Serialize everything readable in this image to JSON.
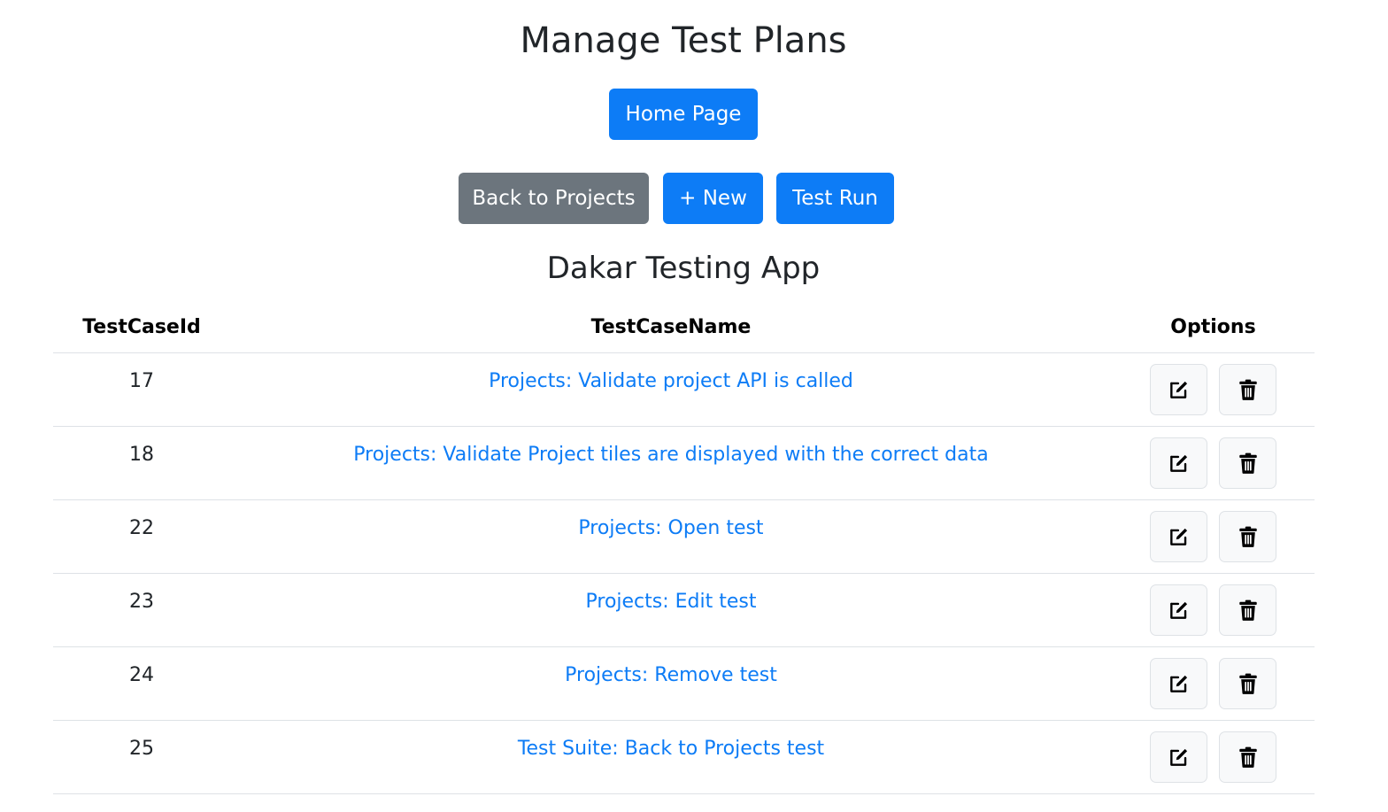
{
  "page": {
    "title": "Manage Test Plans"
  },
  "nav": {
    "home_label": "Home Page",
    "back_label": "Back to Projects",
    "new_label": "+ New",
    "run_label": "Test Run"
  },
  "project": {
    "name": "Dakar Testing App"
  },
  "table": {
    "headers": {
      "id": "TestCaseId",
      "name": "TestCaseName",
      "options": "Options"
    },
    "rows": [
      {
        "id": "17",
        "name": "Projects: Validate project API is called"
      },
      {
        "id": "18",
        "name": "Projects: Validate Project tiles are displayed with the correct data"
      },
      {
        "id": "22",
        "name": "Projects: Open test"
      },
      {
        "id": "23",
        "name": "Projects: Edit test"
      },
      {
        "id": "24",
        "name": "Projects: Remove test"
      },
      {
        "id": "25",
        "name": "Test Suite: Back to Projects test"
      }
    ]
  },
  "icons": {
    "edit": "edit-icon",
    "delete": "trash-icon"
  },
  "colors": {
    "primary": "#0d7cf6",
    "secondary": "#6c757d",
    "link": "#0d7cf6"
  }
}
